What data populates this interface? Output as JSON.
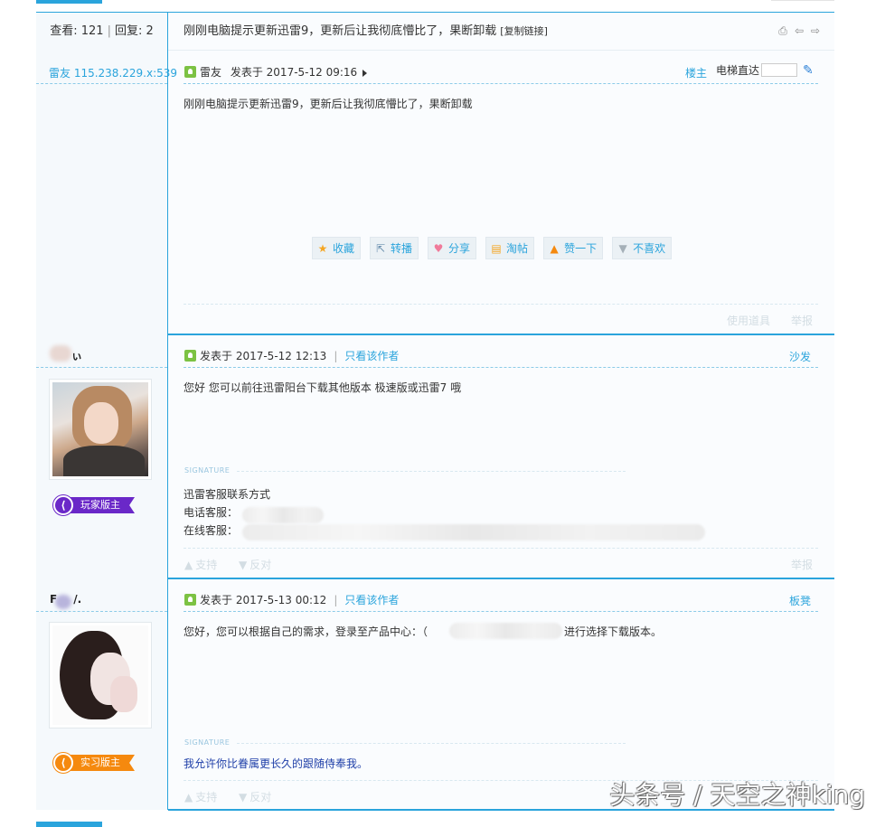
{
  "thread": {
    "views_label": "查看: 121",
    "replies_label": "回复: 2",
    "separator": "|",
    "title": "刚刚电脑提示更新迅雷9，更新后让我彻底懵比了，果断卸载",
    "copy_link": "[复制链接]"
  },
  "icons": {
    "print": "⎙",
    "prev": "⇦",
    "next": "⇨"
  },
  "posts": [
    {
      "author": "雷友 115.238.229.x:539",
      "online_label": "雷友",
      "meta": "发表于 2017-5-12 09:16",
      "floor": "楼主",
      "jump_label": "电梯直达",
      "jump_go": "✎",
      "content": "刚刚电脑提示更新迅雷9，更新后让我彻底懵比了，果断卸载",
      "actions": [
        {
          "icon": "★",
          "label": "收藏",
          "color": "#f5a623"
        },
        {
          "icon": "⇱",
          "label": "转播",
          "color": "#6a8fae"
        },
        {
          "icon": "♥",
          "label": "分享",
          "color": "#f07a9a"
        },
        {
          "icon": "▤",
          "label": "淘帖",
          "color": "#f5a623"
        },
        {
          "icon": "▲",
          "label": "赞一下",
          "color": "#f5890e"
        },
        {
          "icon": "▼",
          "label": "不喜欢",
          "color": "#a5b0b8"
        }
      ],
      "use_tool": "使用道具",
      "report": "举报"
    },
    {
      "author_suffix": "ぃ",
      "meta": "发表于 2017-5-12 12:13",
      "only_author": "只看该作者",
      "floor": "沙发",
      "content": "您好 您可以前往迅雷阳台下载其他版本 极速版或迅雷7 哦",
      "badge": "玩家版主",
      "signature_label": "SIGNATURE",
      "sig_lines": [
        "迅雷客服联系方式",
        "电话客服：",
        "在线客服："
      ],
      "support": "支持",
      "oppose": "反对",
      "report": "举报"
    },
    {
      "author_prefix": "F",
      "author_suffix": "/.",
      "meta": "发表于 2017-5-13 00:12",
      "only_author": "只看该作者",
      "floor": "板凳",
      "content_before": "您好，您可以根据自己的需求，登录至产品中心：（",
      "content_after": "进行选择下载版本。",
      "badge": "实习版主",
      "signature_label": "SIGNATURE",
      "sig_line": "我允许你比眷属更长久的跟随侍奉我。",
      "support": "支持",
      "oppose": "反对"
    }
  ],
  "watermark": "头条号 / 天空之神king"
}
